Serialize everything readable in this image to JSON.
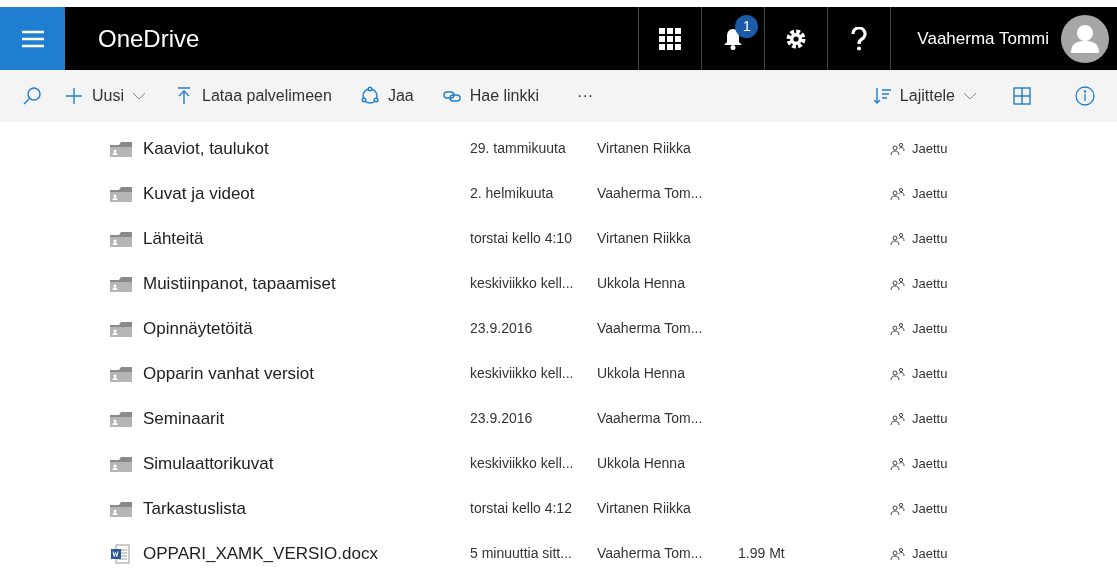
{
  "header": {
    "app_title": "OneDrive",
    "notification_count": "1",
    "user_name": "Vaaherma Tommi"
  },
  "toolbar": {
    "left": [
      {
        "kind": "new",
        "label": "Uusi"
      },
      {
        "kind": "upload",
        "label": "Lataa palvelimeen"
      },
      {
        "kind": "share",
        "label": "Jaa"
      },
      {
        "kind": "link",
        "label": "Hae linkki"
      }
    ],
    "more": "···",
    "sort": "Lajittele"
  },
  "files": [
    {
      "kind": "folder",
      "name": "Kaaviot, taulukot",
      "modified": "29. tammikuuta",
      "modified_by": "Virtanen Riikka",
      "sharing": "Jaettu"
    },
    {
      "kind": "folder",
      "name": "Kuvat ja videot",
      "modified": "2. helmikuuta",
      "modified_by": "Vaaherma Tom...",
      "sharing": "Jaettu"
    },
    {
      "kind": "folder",
      "name": "Lähteitä",
      "modified": "torstai kello 4:10",
      "modified_by": "Virtanen Riikka",
      "sharing": "Jaettu"
    },
    {
      "kind": "folder",
      "name": "Muistiinpanot, tapaamiset",
      "modified": "keskiviikko kell...",
      "modified_by": "Ukkola Henna",
      "sharing": "Jaettu"
    },
    {
      "kind": "folder",
      "name": "Opinnäytetöitä",
      "modified": "23.9.2016",
      "modified_by": "Vaaherma Tom...",
      "sharing": "Jaettu"
    },
    {
      "kind": "folder",
      "name": "Opparin vanhat versiot",
      "modified": "keskiviikko kell...",
      "modified_by": "Ukkola Henna",
      "sharing": "Jaettu"
    },
    {
      "kind": "folder",
      "name": "Seminaarit",
      "modified": "23.9.2016",
      "modified_by": "Vaaherma Tom...",
      "sharing": "Jaettu"
    },
    {
      "kind": "folder",
      "name": "Simulaattorikuvat",
      "modified": "keskiviikko kell...",
      "modified_by": "Ukkola Henna",
      "sharing": "Jaettu"
    },
    {
      "kind": "folder",
      "name": "Tarkastuslista",
      "modified": "torstai kello 4:12",
      "modified_by": "Virtanen Riikka",
      "sharing": "Jaettu"
    },
    {
      "kind": "document",
      "name": "OPPARI_XAMK_VERSIO.docx",
      "modified": "5 minuuttia sitt...",
      "modified_by": "Vaaherma Tom...",
      "size": "1.99 Mt",
      "sharing": "Jaettu"
    }
  ]
}
